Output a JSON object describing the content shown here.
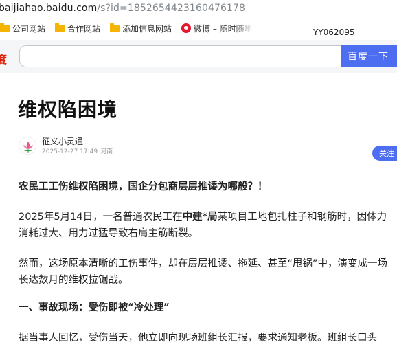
{
  "browser": {
    "url_host": "baijiahao.baidu.com",
    "url_path": "/s?id=1852654423160476178",
    "bookmarks": [
      {
        "label": "公司网站",
        "icon": "folder-icon"
      },
      {
        "label": "合作网站",
        "icon": "folder-icon"
      },
      {
        "label": "添加信息网站",
        "icon": "folder-icon"
      },
      {
        "label": "微博 – 随时随地",
        "icon": "weibo-icon"
      }
    ],
    "overlay_text": "YY062095"
  },
  "search": {
    "logo_fragment": "度",
    "placeholder": "",
    "button_label": "百度一下",
    "accent": "#4e6ef2"
  },
  "article": {
    "title": "维权陷困境",
    "author": "征义小灵通",
    "date": "2025-12-27 17:49",
    "location": "河南",
    "follow_label": "关注",
    "lead": "农民工工伤维权陷困境，国企分包商层层推诿为哪般？！",
    "para1_line1_pre": "2025年5月14日，一名普通农民工在",
    "para1_line1_bold": "中建*局",
    "para1_line1_post": "某项目工地包扎柱子和钢筋时，因体力",
    "para1_line2": "消耗过大、用力过猛导致右肩主筋断裂。",
    "para2_line1": "然而，这场原本清晰的工伤事件，却在层层推诿、拖延、甚至“甩锅”中，演变成一场",
    "para2_line2": "长达数月的维权拉锯战。",
    "heading1": "一、事故现场：受伤即被“冷处理”",
    "para3_line1": "据当事人回忆，受伤当天，他立即向现场班组长汇报，要求通知老板。班组长口头"
  }
}
